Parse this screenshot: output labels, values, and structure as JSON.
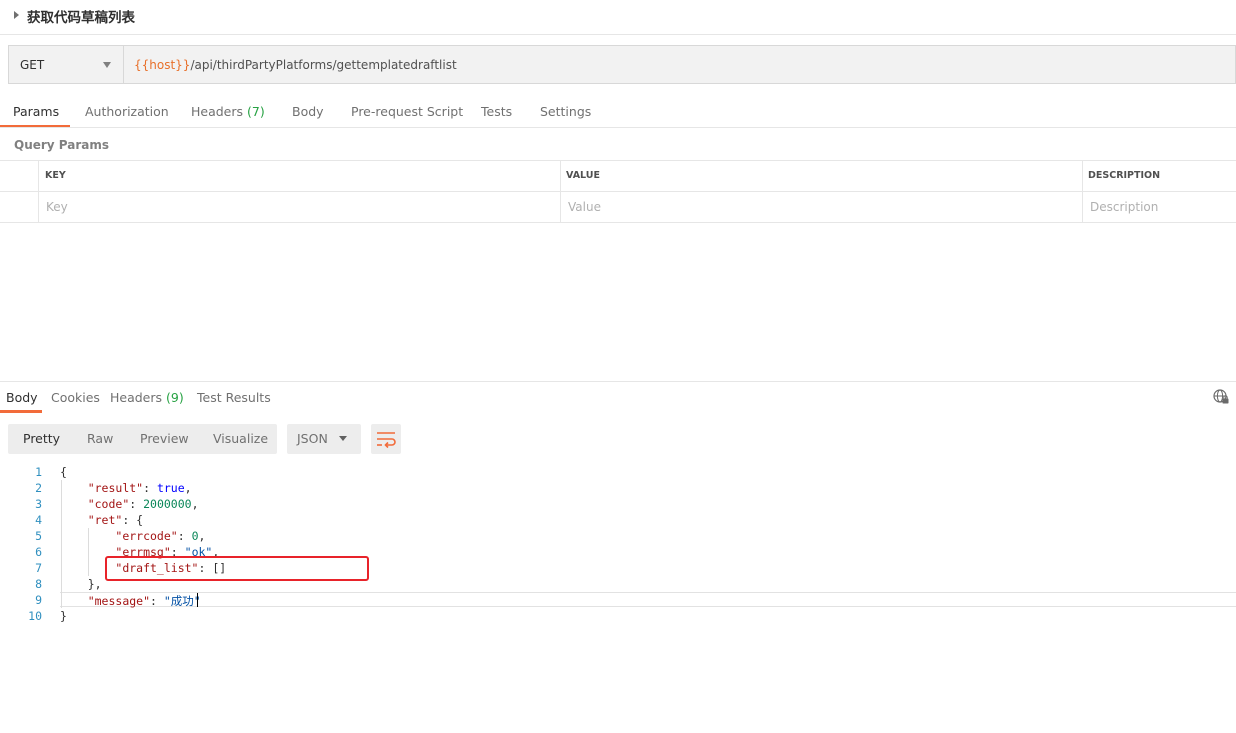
{
  "request": {
    "title": "获取代码草稿列表",
    "method": "GET",
    "url_variable": "{{host}}",
    "url_path": "/api/thirdPartyPlatforms/gettemplatedraftlist"
  },
  "request_tabs": [
    {
      "label": "Params",
      "count": ""
    },
    {
      "label": "Authorization",
      "count": ""
    },
    {
      "label": "Headers",
      "count": "(7)"
    },
    {
      "label": "Body",
      "count": ""
    },
    {
      "label": "Pre-request Script",
      "count": ""
    },
    {
      "label": "Tests",
      "count": ""
    },
    {
      "label": "Settings",
      "count": ""
    }
  ],
  "active_request_tab": "Params",
  "query_params": {
    "label": "Query Params",
    "columns": [
      "KEY",
      "VALUE",
      "DESCRIPTION"
    ],
    "placeholders": [
      "Key",
      "Value",
      "Description"
    ]
  },
  "response_tabs": [
    {
      "label": "Body",
      "count": ""
    },
    {
      "label": "Cookies",
      "count": ""
    },
    {
      "label": "Headers",
      "count": "(9)"
    },
    {
      "label": "Test Results",
      "count": ""
    }
  ],
  "active_response_tab": "Body",
  "view_modes": [
    "Pretty",
    "Raw",
    "Preview",
    "Visualize"
  ],
  "active_view_mode": "Pretty",
  "format": "JSON",
  "icons": {
    "collapse": "caret-right-icon",
    "method_dropdown": "chevron-down-icon",
    "globe": "globe-lock-icon",
    "wrap": "wrap-lines-icon"
  },
  "colors": {
    "accent": "#f26b3a",
    "count": "#27a243",
    "url_variable": "#e8702a",
    "highlight_box": "#e8232a"
  },
  "code": {
    "line_numbers": [
      "1",
      "2",
      "3",
      "4",
      "5",
      "6",
      "7",
      "8",
      "9",
      "10"
    ],
    "lines": [
      [
        {
          "t": "p",
          "v": "{"
        }
      ],
      [
        {
          "t": "p",
          "v": "    "
        },
        {
          "t": "k",
          "v": "\"result\""
        },
        {
          "t": "p",
          "v": ": "
        },
        {
          "t": "b",
          "v": "true"
        },
        {
          "t": "p",
          "v": ","
        }
      ],
      [
        {
          "t": "p",
          "v": "    "
        },
        {
          "t": "k",
          "v": "\"code\""
        },
        {
          "t": "p",
          "v": ": "
        },
        {
          "t": "n",
          "v": "2000000"
        },
        {
          "t": "p",
          "v": ","
        }
      ],
      [
        {
          "t": "p",
          "v": "    "
        },
        {
          "t": "k",
          "v": "\"ret\""
        },
        {
          "t": "p",
          "v": ": {"
        }
      ],
      [
        {
          "t": "p",
          "v": "        "
        },
        {
          "t": "k",
          "v": "\"errcode\""
        },
        {
          "t": "p",
          "v": ": "
        },
        {
          "t": "n",
          "v": "0"
        },
        {
          "t": "p",
          "v": ","
        }
      ],
      [
        {
          "t": "p",
          "v": "        "
        },
        {
          "t": "k",
          "v": "\"errmsg\""
        },
        {
          "t": "p",
          "v": ": "
        },
        {
          "t": "s",
          "v": "\"ok\""
        },
        {
          "t": "p",
          "v": ","
        }
      ],
      [
        {
          "t": "p",
          "v": "        "
        },
        {
          "t": "k",
          "v": "\"draft_list\""
        },
        {
          "t": "p",
          "v": ": []"
        }
      ],
      [
        {
          "t": "p",
          "v": "    },"
        }
      ],
      [
        {
          "t": "p",
          "v": "    "
        },
        {
          "t": "k",
          "v": "\"message\""
        },
        {
          "t": "p",
          "v": ": "
        },
        {
          "t": "s",
          "v": "\"成功\""
        }
      ],
      [
        {
          "t": "p",
          "v": "}"
        }
      ]
    ]
  }
}
